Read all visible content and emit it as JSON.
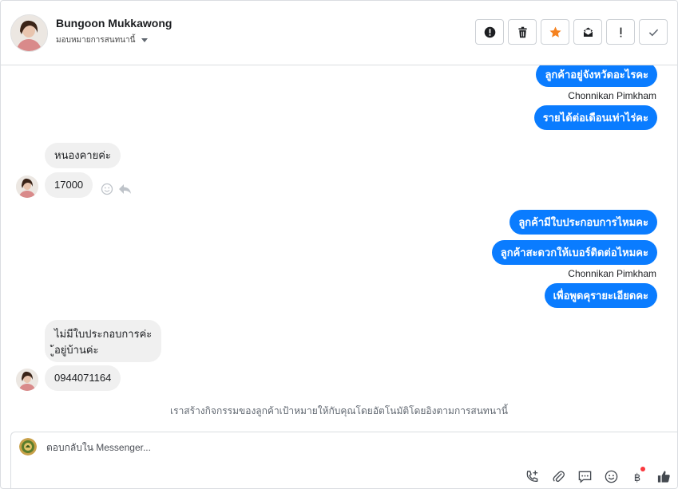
{
  "header": {
    "contact_name": "Bungoon Mukkawong",
    "assign_label": "มอบหมายการสนทนานี้",
    "actions": [
      {
        "name": "report-spam-button",
        "icon": "alert-circle-icon"
      },
      {
        "name": "delete-button",
        "icon": "trash-icon"
      },
      {
        "name": "star-button",
        "icon": "star-icon"
      },
      {
        "name": "mark-unread-button",
        "icon": "envelope-icon"
      },
      {
        "name": "follow-up-button",
        "icon": "exclamation-icon"
      },
      {
        "name": "mark-done-button",
        "icon": "checkmark-icon"
      }
    ]
  },
  "colors": {
    "outgoing": "#0a7cff",
    "incoming": "#f0f0f0",
    "star": "#f5821f"
  },
  "messages": {
    "out1": "ลูกค้าอยู่จังหวัดอะไรคะ",
    "sender1": "Chonnikan Pimkham",
    "out2": "รายได้ต่อเดือนเท่าไร่คะ",
    "in1": "หนองคายค่ะ",
    "in2": "17000",
    "out3": "ลูกค้ามีใบประกอบการไหมคะ",
    "out4": "ลูกค้าสะดวกให้เบอร์ติดต่อไหมคะ",
    "sender2": "Chonnikan Pimkham",
    "out5": "เพื่อพูดคุรายะเอียดคะ",
    "in3_line1": "ไม่มีใบประกอบการค่ะ",
    "in3_line2": "ู้อยู่บ้านค่ะ",
    "in4": "0944071164"
  },
  "notice": "เราสร้างกิจกรรมของลูกค้าเป้าหมายให้กับคุณโดยอัตโนมัติโดยอิงตามการสนทนานี้",
  "composer": {
    "placeholder": "ตอบกลับใน Messenger...",
    "icons": [
      "add-contact-icon",
      "attachment-icon",
      "saved-reply-icon",
      "emoji-icon",
      "baht-payment-icon",
      "like-icon"
    ]
  }
}
